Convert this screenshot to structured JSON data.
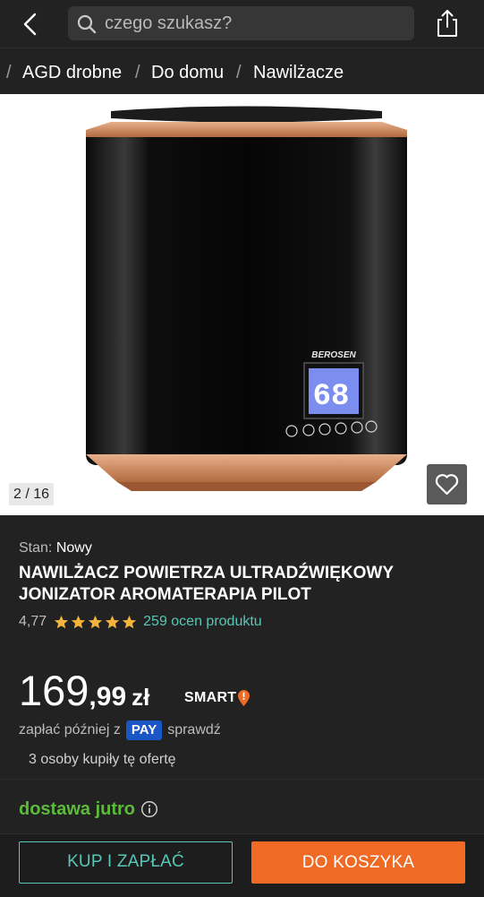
{
  "search": {
    "placeholder": "czego szukasz?"
  },
  "breadcrumb": {
    "items": [
      "AGD drobne",
      "Do domu",
      "Nawilżacze"
    ],
    "separator": "/"
  },
  "gallery": {
    "counter": "2 / 16",
    "brand_on_device": "BEROSEN",
    "display_reading": "68",
    "icons": [
      "chevron-left-icon",
      "search-icon",
      "share-icon",
      "heart-icon"
    ]
  },
  "product": {
    "condition_label": "Stan:",
    "condition_value": "Nowy",
    "title": "NAWILŻACZ POWIETRZA ULTRADŹWIĘKOWY JONIZATOR AROMATERAPIA PILOT",
    "rating_value": "4,77",
    "stars": 5,
    "rating_count": "259 ocen produktu"
  },
  "price": {
    "integer": "169",
    "decimal": ",99",
    "currency": "zł",
    "smart": "SMART"
  },
  "pay_later": {
    "prefix": "zapłać później z",
    "badge": "PAY",
    "suffix": "sprawdź"
  },
  "social_proof": "3 osoby kupiły tę ofertę",
  "delivery": {
    "text": "dostawa jutro"
  },
  "actions": {
    "buy_now": "KUP I ZAPŁAĆ",
    "add_to_cart": "DO KOSZYKA"
  },
  "colors": {
    "background": "#222222",
    "teal": "#59c7b6",
    "orange": "#ee6a25",
    "green": "#5cbb3a",
    "star": "#f5b53a",
    "pay_blue": "#1a56c6"
  }
}
